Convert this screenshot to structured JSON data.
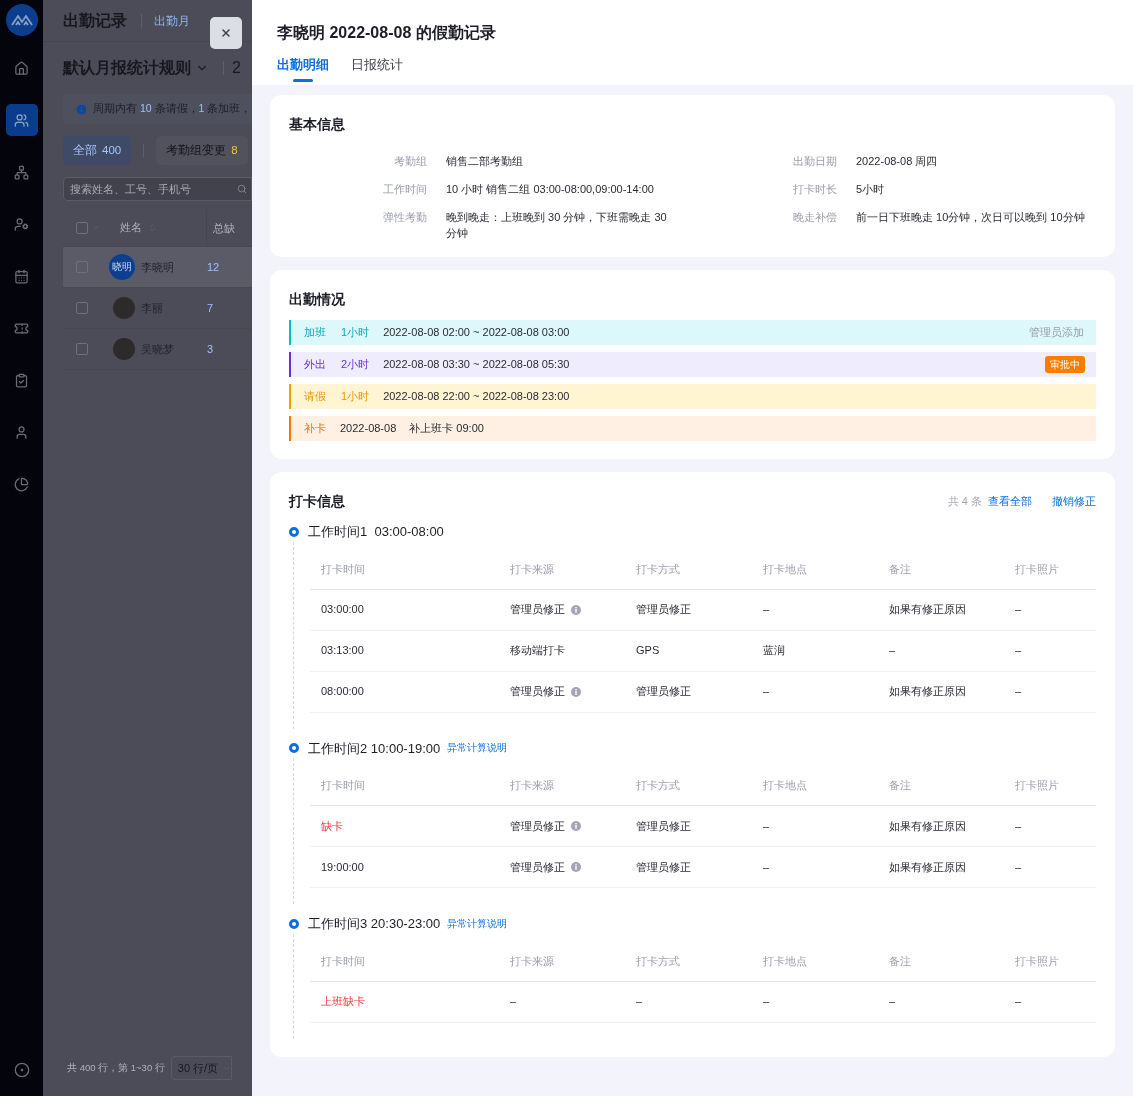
{
  "sidebar": {
    "items": [
      {
        "selected": false
      },
      {
        "selected": true
      },
      {
        "selected": false
      },
      {
        "selected": false
      },
      {
        "selected": false
      },
      {
        "selected": false
      },
      {
        "selected": false
      },
      {
        "selected": false
      },
      {
        "selected": false
      }
    ]
  },
  "page": {
    "title": "出勤记录",
    "tab": "出勤月",
    "rule": "默认月报统计规则",
    "rule_next": "2",
    "notice": [
      {
        "text": "周期内有 ",
        "highlight": false
      },
      {
        "text": "10",
        "highlight": true
      },
      {
        "text": " 条请假，",
        "highlight": false
      },
      {
        "text": "1",
        "highlight": true
      },
      {
        "text": " 条加班，",
        "highlight": false
      }
    ],
    "filters": [
      {
        "label": "全部",
        "count": "400",
        "selected": true
      },
      {
        "label": "考勤组变更",
        "count": "8",
        "selected": false
      }
    ],
    "search": {
      "placeholder": "搜索姓名、工号、手机号"
    },
    "table": {
      "checked": false,
      "columns": [
        "姓名",
        "总缺"
      ],
      "rows": [
        {
          "name": "李晓明",
          "avatar": "晓明",
          "value": "12",
          "selected": true,
          "checked": false
        },
        {
          "name": "李丽",
          "value": "7",
          "selected": false,
          "checked": false
        },
        {
          "name": "吴晓梦",
          "value": "3",
          "selected": false,
          "checked": false
        }
      ]
    },
    "footer": {
      "summary": "共 400 行，第 1~30 行",
      "page_size": "30 行/页"
    }
  },
  "drawer": {
    "title": "李晓明 2022-08-08 的假勤记录",
    "tabs": [
      {
        "label": "出勤明细",
        "selected": true
      },
      {
        "label": "日报统计",
        "selected": false
      }
    ],
    "basic": {
      "title": "基本信息",
      "left": [
        {
          "label": "考勤组",
          "value": "销售二部考勤组"
        },
        {
          "label": "工作时间",
          "value": "10 小时  销售二组 03:00-08:00,09:00-14:00"
        },
        {
          "label": "弹性考勤",
          "value": "晚到晚走：上班晚到 30 分钟，下班需晚走 30 分钟"
        }
      ],
      "right": [
        {
          "label": "出勤日期",
          "value": "2022-08-08  周四"
        },
        {
          "label": "打卡时长",
          "value": "5小时"
        },
        {
          "label": "晚走补偿",
          "value": "前一日下班晚走 10分钟，次日可以晚到 10分钟"
        }
      ]
    },
    "attendance": {
      "title": "出勤情况",
      "items": [
        {
          "kind": "overtime",
          "type": "加班",
          "duration": "1小时",
          "time": "2022-08-08 02:00 ~ 2022-08-08 03:00",
          "note": "管理员添加"
        },
        {
          "kind": "out",
          "type": "外出",
          "duration": "2小时",
          "time": "2022-08-08 03:30 ~ 2022-08-08 05:30",
          "badge": "审批中"
        },
        {
          "kind": "leave",
          "type": "请假",
          "duration": "1小时",
          "time": "2022-08-08 22:00 ~ 2022-08-08 23:00"
        },
        {
          "kind": "makeup",
          "type": "补卡",
          "time": "2022-08-08",
          "detail": "补上班卡 09:00"
        }
      ]
    },
    "punch": {
      "title": "打卡信息",
      "total": "共 4 条",
      "view_all": "查看全部",
      "revoke": "撤销修正",
      "shifts": [
        {
          "title": "工作时间1  03:00-08:00",
          "columns": [
            "打卡时间",
            "打卡来源",
            "打卡方式",
            "打卡地点",
            "备注",
            "打卡照片"
          ],
          "rows": [
            {
              "time": "03:00:00",
              "missing": false,
              "source": "管理员修正",
              "info": true,
              "method": "管理员修正",
              "place": "–",
              "note": "如果有修正原因",
              "photo": "–"
            },
            {
              "time": "03:13:00",
              "missing": false,
              "source": "移动端打卡",
              "info": false,
              "method": "GPS",
              "place": "蓝润",
              "note": "–",
              "photo": "–"
            },
            {
              "time": "08:00:00",
              "missing": false,
              "source": "管理员修正",
              "info": true,
              "method": "管理员修正",
              "place": "–",
              "note": "如果有修正原因",
              "photo": "–"
            }
          ]
        },
        {
          "title": "工作时间2 10:00-19:00",
          "link": "异常计算说明",
          "columns": [
            "打卡时间",
            "打卡来源",
            "打卡方式",
            "打卡地点",
            "备注",
            "打卡照片"
          ],
          "rows": [
            {
              "time": "缺卡",
              "missing": true,
              "source": "管理员修正",
              "info": true,
              "method": "管理员修正",
              "place": "–",
              "note": "如果有修正原因",
              "photo": "–"
            },
            {
              "time": "19:00:00",
              "missing": false,
              "source": "管理员修正",
              "info": true,
              "method": "管理员修正",
              "place": "–",
              "note": "如果有修正原因",
              "photo": "–"
            }
          ]
        },
        {
          "title": "工作时间3 20:30-23:00",
          "link": "异常计算说明",
          "columns": [
            "打卡时间",
            "打卡来源",
            "打卡方式",
            "打卡地点",
            "备注",
            "打卡照片"
          ],
          "rows": [
            {
              "time": "上班缺卡",
              "missing": true,
              "source": "–",
              "info": false,
              "method": "–",
              "place": "–",
              "note": "–",
              "photo": "–"
            }
          ]
        }
      ]
    }
  }
}
